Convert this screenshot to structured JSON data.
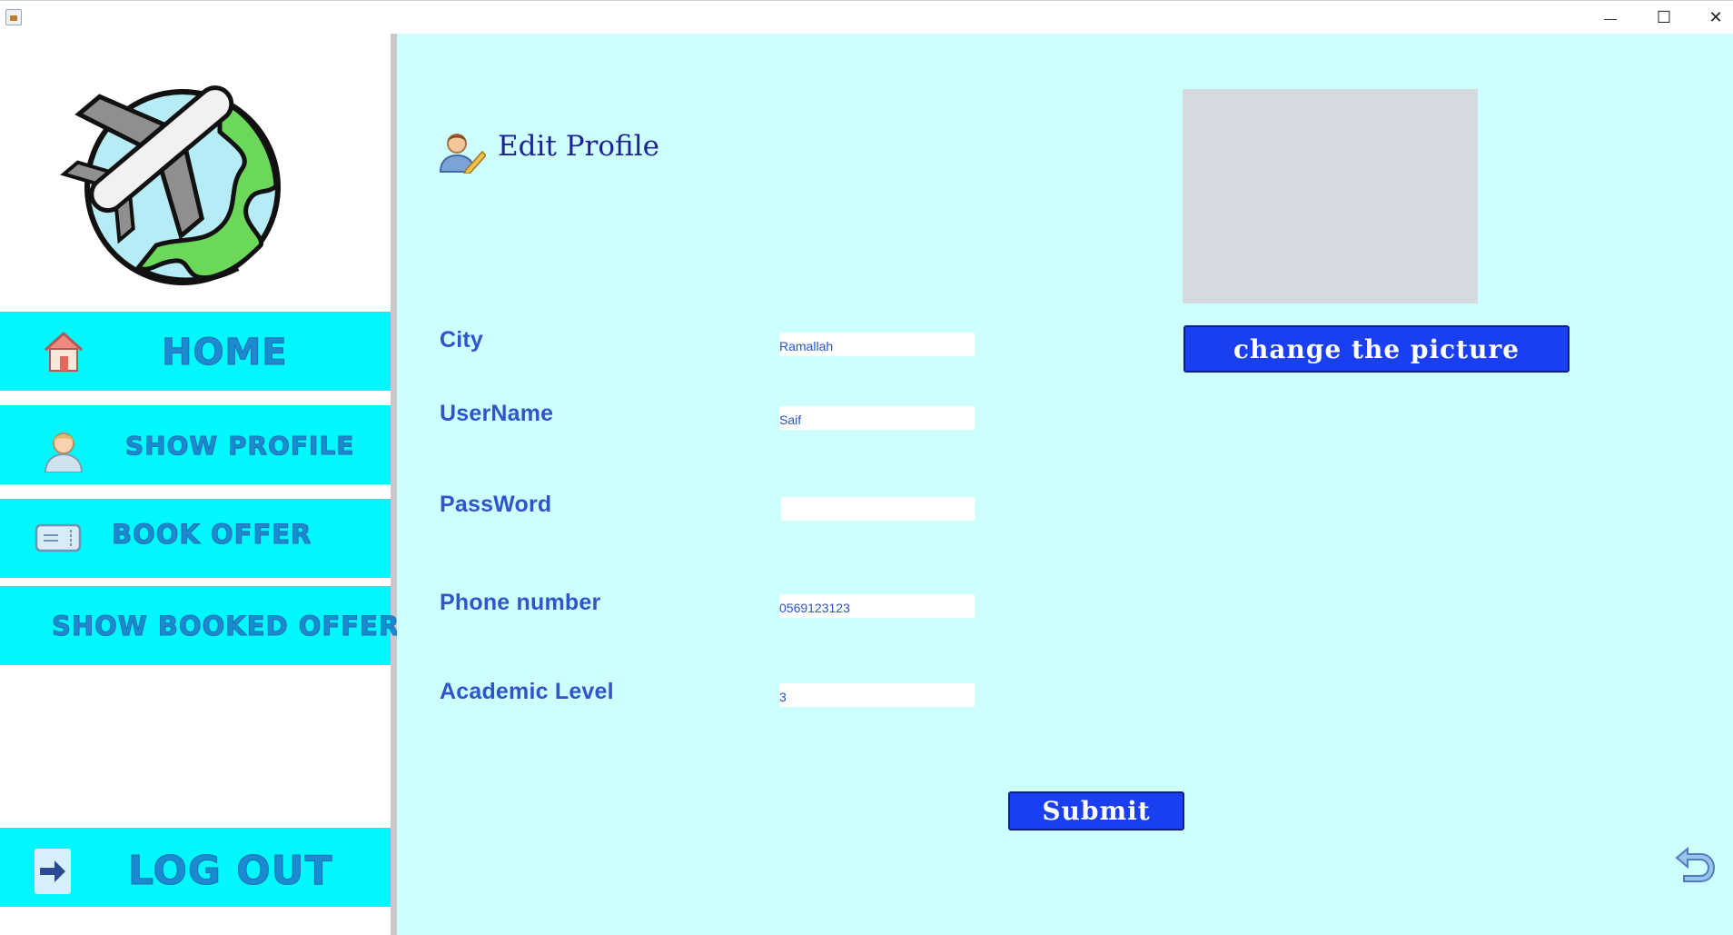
{
  "window": {
    "minimize_glyph": "—",
    "maximize_glyph": "☐",
    "close_glyph": "✕"
  },
  "sidebar": {
    "nav": [
      {
        "label": "HOME",
        "icon": "house-icon"
      },
      {
        "label": "SHOW PROFILE",
        "icon": "user-avatar-icon"
      },
      {
        "label": "BOOK OFFER",
        "icon": "ticket-icon"
      },
      {
        "label": "SHOW BOOKED OFFERS",
        "icon": ""
      }
    ],
    "logout": {
      "label": "LOG OUT",
      "icon": "logout-arrow-icon"
    },
    "logo": "airplane-globe-logo"
  },
  "main": {
    "title": "Edit Profile",
    "title_icon": "user-edit-icon",
    "fields": {
      "city": {
        "label": "City",
        "value": "Ramallah"
      },
      "username": {
        "label": "UserName",
        "value": "Saif"
      },
      "password": {
        "label": "PassWord",
        "value": ""
      },
      "phone": {
        "label": "Phone number",
        "value": "0569123123"
      },
      "academic": {
        "label": "Academic Level",
        "value": "3"
      }
    },
    "change_picture_label": "change the picture",
    "submit_label": "Submit",
    "back_icon": "undo-arrow-icon"
  },
  "colors": {
    "nav_bg": "#00f7fb",
    "main_bg": "#ccfffd",
    "accent_button": "#1a3ff0",
    "label_blue": "#2f55c8"
  }
}
